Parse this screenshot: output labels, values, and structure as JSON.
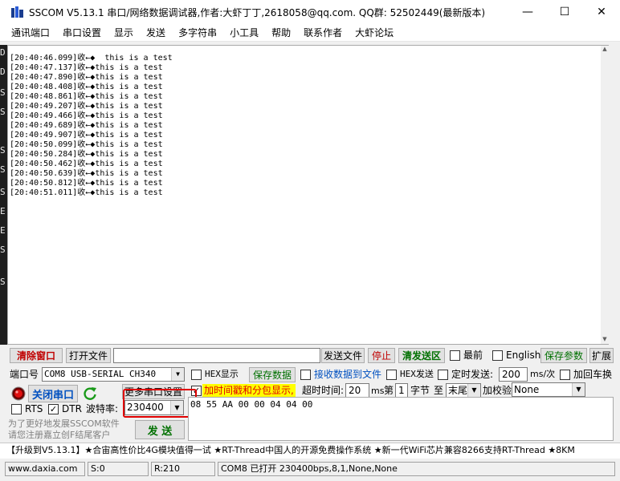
{
  "window": {
    "title": "SSCOM V5.13.1 串口/网络数据调试器,作者:大虾丁丁,2618058@qq.com. QQ群:  52502449(最新版本)",
    "minimize_glyph": "—",
    "maximize_glyph": "☐",
    "close_glyph": "✕"
  },
  "menu": {
    "items": [
      "通讯端口",
      "串口设置",
      "显示",
      "发送",
      "多字符串",
      "小工具",
      "帮助",
      "联系作者",
      "大虾论坛"
    ]
  },
  "background_window": {
    "letters": [
      "D",
      "D",
      "S",
      "S",
      "S",
      "S",
      "S",
      "E",
      "E",
      "S",
      "S"
    ]
  },
  "receive": {
    "lines": [
      "[20:40:46.099]收←◆  this is a test",
      "[20:40:47.137]收←◆this is a test",
      "[20:40:47.890]收←◆this is a test",
      "[20:40:48.408]收←◆this is a test",
      "[20:40:48.861]收←◆this is a test",
      "[20:40:49.207]收←◆this is a test",
      "[20:40:49.466]收←◆this is a test",
      "[20:40:49.689]收←◆this is a test",
      "[20:40:49.907]收←◆this is a test",
      "[20:40:50.099]收←◆this is a test",
      "[20:40:50.284]收←◆this is a test",
      "[20:40:50.462]收←◆this is a test",
      "[20:40:50.639]收←◆this is a test",
      "[20:40:50.812]收←◆this is a test",
      "[20:40:51.011]收←◆this is a test"
    ]
  },
  "toolbar1": {
    "clear_window": "清除窗口",
    "open_file": "打开文件",
    "file_path": "",
    "send_file": "发送文件",
    "stop": "停止",
    "clear_send": "清发送区",
    "latest": "最前",
    "english": "English",
    "save_params": "保存参数",
    "expand": "扩展"
  },
  "toolbar2": {
    "port_label": "端口号",
    "port_value": "COM8 USB-SERIAL CH340",
    "hex_display": "HEX显示",
    "save_data": "保存数据",
    "recv_to_file": "接收数据到文件",
    "hex_send": "HEX发送",
    "timed_send": "定时发送:",
    "interval": "200",
    "interval_unit": "ms/次",
    "add_crlf": "加回车换"
  },
  "toolbar3": {
    "close_port": "关闭串口",
    "more_settings": "更多串口设置",
    "add_timestamp": "加时间戳和分包显示,",
    "timeout_label": "超时时间:",
    "timeout_value": "20",
    "timeout_unit": "ms",
    "frame_prefix": "第",
    "frame_value": "1",
    "byte_label": "字节",
    "to_label": "至",
    "end_value": "末尾",
    "checksum_label": "加校验",
    "checksum_value": "None"
  },
  "toolbar4": {
    "rts": "RTS",
    "dtr": "DTR",
    "baud_label": "波特率:",
    "baud_value": "230400",
    "promo_line1": "为了更好地发展SSCOM软件",
    "promo_line2": "请您注册嘉立创F结尾客户",
    "send": "发  送"
  },
  "send_area": {
    "content": "08 55 AA 00 00 04 04 00"
  },
  "ticker": {
    "text": "【升级到V5.13.1】★合宙高性价比4G模块值得一试 ★RT-Thread中国人的开源免费操作系统 ★新一代WiFi芯片兼容8266支持RT-Thread ★8KM"
  },
  "status": {
    "website": "www.daxia.com",
    "sent": "S:0",
    "received": "R:210",
    "port_status": "COM8 已打开  230400bps,8,1,None,None"
  },
  "colors": {
    "highlight_yellow": "#ffff00",
    "accent_red": "#e00000",
    "text_blue": "#0050c0",
    "text_green": "#007000"
  }
}
